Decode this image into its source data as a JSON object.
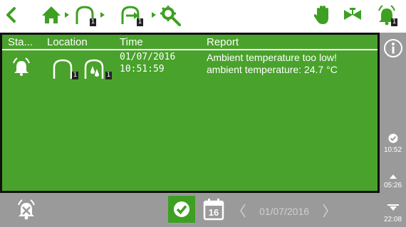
{
  "toolbar": {
    "badge_house": "1",
    "badge_transfer": "1",
    "badge_alarm": "1"
  },
  "table": {
    "headers": [
      "Sta...",
      "Location",
      "Time",
      "Report"
    ],
    "rows": [
      {
        "location_badge_1": "1",
        "location_badge_2": "1",
        "date": "01/07/2016",
        "time": "10:51:59",
        "report_line1": "Ambient temperature too low!",
        "report_line2": "ambient temperature: 24.7 °C"
      }
    ]
  },
  "sidebar": {
    "times": [
      "10:52",
      "05:26",
      "22:08"
    ]
  },
  "bottom": {
    "calendar_day": "16",
    "date": "01/07/2016"
  },
  "colors": {
    "panel_green": "#49a22b",
    "icon_green": "#3da022",
    "bar_gray": "#9a9a9a"
  }
}
